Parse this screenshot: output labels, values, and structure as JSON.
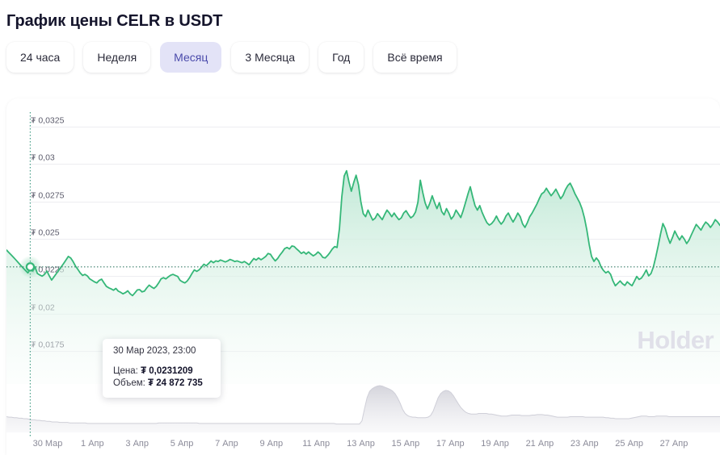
{
  "header": {
    "title": "График цены CELR в USDT"
  },
  "range_selector": {
    "options": [
      {
        "label": "24 часа",
        "active": false
      },
      {
        "label": "Неделя",
        "active": false
      },
      {
        "label": "Месяц",
        "active": true
      },
      {
        "label": "3 Месяца",
        "active": false
      },
      {
        "label": "Год",
        "active": false
      },
      {
        "label": "Всё время",
        "active": false
      }
    ],
    "active_label": "Месяц"
  },
  "watermark": {
    "text": "Holder"
  },
  "tooltip": {
    "date": "30 Мар 2023, 23:00",
    "price_label": "Цена:",
    "price_value": "₮ 0,0231209",
    "volume_label": "Объем:",
    "volume_value": "₮ 24 872 735"
  },
  "colors": {
    "line": "#35b778",
    "area_top": "#cfeedf",
    "area_bottom": "#f6fcf9",
    "volume": "#dcdce2",
    "grid": "#ededf1",
    "crosshair": "#4aa08a",
    "accent_button_bg": "#e3e3f7",
    "accent_button_text": "#4b4bab",
    "watermark": "#e0e0e9"
  },
  "chart_data": {
    "type": "area",
    "title": "График цены CELR в USDT",
    "xlabel": "",
    "ylabel": "",
    "grid": true,
    "legend": "none",
    "currency_symbol": "₮",
    "y_ticks": [
      0.0325,
      0.03,
      0.0275,
      0.025,
      0.0225,
      0.02,
      0.0175
    ],
    "y_tick_labels": [
      "₮ 0,0325",
      "₮ 0,03",
      "₮ 0,0275",
      "₮ 0,025",
      "₮ 0,0225",
      "₮ 0,02",
      "₮ 0,0175"
    ],
    "ylim": [
      0.0165,
      0.0333
    ],
    "x_tick_labels": [
      "30 Мар",
      "1 Апр",
      "3 Апр",
      "5 Апр",
      "7 Апр",
      "9 Апр",
      "11 Апр",
      "13 Апр",
      "15 Апр",
      "17 Апр",
      "19 Апр",
      "21 Апр",
      "23 Апр",
      "25 Апр",
      "27 Апр"
    ],
    "x_range": [
      "30 Мар 2023",
      "28 Апр 2023"
    ],
    "highlight_point": {
      "x_label": "30 Мар 2023, 23:00",
      "price": 0.0231209,
      "volume": 24872735
    },
    "series": [
      {
        "name": "Цена",
        "unit": "₮",
        "values": [
          0.02425,
          0.02408,
          0.02392,
          0.02375,
          0.02358,
          0.0234,
          0.02322,
          0.02305,
          0.02288,
          0.02272,
          0.02296,
          0.02285,
          0.02312,
          0.02268,
          0.02258,
          0.0225,
          0.02262,
          0.02284,
          0.02252,
          0.02224,
          0.02246,
          0.02268,
          0.0229,
          0.02312,
          0.02334,
          0.02358,
          0.02382,
          0.02372,
          0.02348,
          0.02318,
          0.02296,
          0.02272,
          0.02255,
          0.02262,
          0.02252,
          0.02232,
          0.02222,
          0.02212,
          0.02205,
          0.02222,
          0.0223,
          0.02205,
          0.02182,
          0.02172,
          0.02165,
          0.02156,
          0.02168,
          0.0215,
          0.02142,
          0.02132,
          0.0214,
          0.02152,
          0.02132,
          0.0212,
          0.02138,
          0.02158,
          0.0216,
          0.02145,
          0.0215,
          0.02172,
          0.0219,
          0.02178,
          0.02168,
          0.02182,
          0.02205,
          0.02232,
          0.0224,
          0.02232,
          0.02245,
          0.02256,
          0.02262,
          0.02255,
          0.02248,
          0.02222,
          0.02212,
          0.02205,
          0.02218,
          0.0224,
          0.02268,
          0.02292,
          0.02282,
          0.02292,
          0.0231,
          0.0233,
          0.0232,
          0.02335,
          0.02352,
          0.0234,
          0.02352,
          0.02348,
          0.02358,
          0.02352,
          0.02345,
          0.02352,
          0.02362,
          0.02356,
          0.02348,
          0.02352,
          0.02346,
          0.0234,
          0.02348,
          0.02338,
          0.02326,
          0.02348,
          0.02368,
          0.02358,
          0.02372,
          0.0236,
          0.0237,
          0.02382,
          0.02402,
          0.02396,
          0.02372,
          0.02352,
          0.02368,
          0.02392,
          0.02412,
          0.02435,
          0.02442,
          0.02432,
          0.02452,
          0.02448,
          0.02432,
          0.02418,
          0.02402,
          0.02412,
          0.02398,
          0.02412,
          0.02398,
          0.02386,
          0.02396,
          0.02412,
          0.02398,
          0.02376,
          0.02372,
          0.02388,
          0.02408,
          0.02432,
          0.02448,
          0.02442,
          0.02568,
          0.02782,
          0.0292,
          0.02955,
          0.0288,
          0.02818,
          0.02876,
          0.02925,
          0.02862,
          0.02748,
          0.02668,
          0.02648,
          0.02692,
          0.02658,
          0.02625,
          0.02638,
          0.02668,
          0.02648,
          0.02628,
          0.02662,
          0.02692,
          0.02672,
          0.02648,
          0.02672,
          0.02648,
          0.02628,
          0.0264,
          0.02672,
          0.02688,
          0.02662,
          0.0264,
          0.02652,
          0.0268,
          0.02745,
          0.02892,
          0.02812,
          0.02742,
          0.027,
          0.02738,
          0.02788,
          0.02742,
          0.02702,
          0.02742,
          0.02682,
          0.0266,
          0.02702,
          0.02672,
          0.02632,
          0.02652,
          0.02692,
          0.02668,
          0.02642,
          0.02688,
          0.02742,
          0.02798,
          0.02848,
          0.02782,
          0.02722,
          0.02692,
          0.02722,
          0.02676,
          0.0264,
          0.02608,
          0.02592,
          0.02602,
          0.02622,
          0.02652,
          0.0262,
          0.02598,
          0.02618,
          0.02652,
          0.02672,
          0.0264,
          0.02612,
          0.0264,
          0.02672,
          0.02648,
          0.026,
          0.02576,
          0.02608,
          0.02648,
          0.02672,
          0.02702,
          0.02732,
          0.02768,
          0.028,
          0.02812,
          0.02838,
          0.02812,
          0.02788,
          0.02808,
          0.02832,
          0.028,
          0.02768,
          0.0279,
          0.02828,
          0.02856,
          0.02872,
          0.0284,
          0.02802,
          0.02772,
          0.02742,
          0.027,
          0.0264,
          0.0256,
          0.02462,
          0.02382,
          0.02348,
          0.02372,
          0.02352,
          0.02312,
          0.02288,
          0.02272,
          0.02282,
          0.02262,
          0.02218,
          0.02186,
          0.02202,
          0.02218,
          0.022,
          0.02188,
          0.02212,
          0.02198,
          0.02186,
          0.02216,
          0.02248,
          0.02228,
          0.02238,
          0.02262,
          0.02292,
          0.02252,
          0.02268,
          0.02312,
          0.02378,
          0.02452,
          0.02532,
          0.02602,
          0.02568,
          0.02512,
          0.0247,
          0.02508,
          0.02552,
          0.0252,
          0.02492,
          0.0252,
          0.02498,
          0.02468,
          0.02492,
          0.02528,
          0.02562,
          0.02596,
          0.02578,
          0.02558,
          0.02588,
          0.02612,
          0.02598,
          0.02576,
          0.02598,
          0.02628,
          0.02612,
          0.0259
        ]
      },
      {
        "name": "Объем",
        "unit": "₮",
        "values": [
          0.3,
          0.29,
          0.29,
          0.28,
          0.28,
          0.27,
          0.27,
          0.26,
          0.26,
          0.25,
          0.24,
          0.24,
          0.23,
          0.23,
          0.22,
          0.22,
          0.21,
          0.21,
          0.2,
          0.2,
          0.2,
          0.19,
          0.19,
          0.19,
          0.19,
          0.18,
          0.18,
          0.18,
          0.18,
          0.18,
          0.18,
          0.18,
          0.17,
          0.17,
          0.17,
          0.17,
          0.17,
          0.17,
          0.17,
          0.17,
          0.17,
          0.17,
          0.17,
          0.17,
          0.17,
          0.17,
          0.17,
          0.17,
          0.17,
          0.17,
          0.17,
          0.17,
          0.17,
          0.17,
          0.17,
          0.17,
          0.17,
          0.17,
          0.17,
          0.17,
          0.18,
          0.18,
          0.18,
          0.18,
          0.18,
          0.18,
          0.18,
          0.18,
          0.18,
          0.18,
          0.18,
          0.18,
          0.18,
          0.18,
          0.18,
          0.18,
          0.17,
          0.17,
          0.17,
          0.17,
          0.17,
          0.17,
          0.17,
          0.17,
          0.17,
          0.17,
          0.17,
          0.17,
          0.17,
          0.17,
          0.17,
          0.17,
          0.17,
          0.17,
          0.17,
          0.17,
          0.17,
          0.17,
          0.17,
          0.17,
          0.17,
          0.17,
          0.17,
          0.17,
          0.17,
          0.17,
          0.17,
          0.17,
          0.17,
          0.17,
          0.17,
          0.17,
          0.17,
          0.17,
          0.17,
          0.17,
          0.17,
          0.17,
          0.17,
          0.17,
          0.17,
          0.17,
          0.17,
          0.17,
          0.17,
          0.17,
          0.17,
          0.17,
          0.17,
          0.17,
          0.16,
          0.16,
          0.16,
          0.16,
          0.16,
          0.16,
          0.16,
          0.16,
          0.16,
          0.16,
          0.22,
          0.45,
          0.66,
          0.78,
          0.83,
          0.86,
          0.88,
          0.89,
          0.88,
          0.86,
          0.84,
          0.82,
          0.79,
          0.74,
          0.66,
          0.56,
          0.44,
          0.36,
          0.32,
          0.3,
          0.29,
          0.29,
          0.28,
          0.28,
          0.28,
          0.28,
          0.29,
          0.32,
          0.4,
          0.53,
          0.66,
          0.74,
          0.78,
          0.8,
          0.79,
          0.76,
          0.7,
          0.62,
          0.54,
          0.47,
          0.42,
          0.38,
          0.36,
          0.35,
          0.35,
          0.35,
          0.36,
          0.36,
          0.36,
          0.36,
          0.35,
          0.35,
          0.34,
          0.33,
          0.32,
          0.31,
          0.31,
          0.31,
          0.32,
          0.33,
          0.33,
          0.33,
          0.33,
          0.32,
          0.32,
          0.32,
          0.32,
          0.33,
          0.33,
          0.34,
          0.34,
          0.34,
          0.33,
          0.33,
          0.32,
          0.31,
          0.3,
          0.29,
          0.29,
          0.29,
          0.29,
          0.29,
          0.3,
          0.3,
          0.3,
          0.3,
          0.3,
          0.3,
          0.29,
          0.29,
          0.29,
          0.29,
          0.29,
          0.29,
          0.29,
          0.29,
          0.28,
          0.28,
          0.27,
          0.27,
          0.26,
          0.26,
          0.26,
          0.26,
          0.26,
          0.26,
          0.27,
          0.28,
          0.29,
          0.3,
          0.31,
          0.31,
          0.31,
          0.3,
          0.3,
          0.3,
          0.31,
          0.31,
          0.31,
          0.31,
          0.31,
          0.3,
          0.3,
          0.3,
          0.3,
          0.3,
          0.3,
          0.3,
          0.3,
          0.3,
          0.3,
          0.3,
          0.3,
          0.3,
          0.3,
          0.3,
          0.3,
          0.3,
          0.3,
          0.3,
          0.3,
          0.3
        ]
      }
    ]
  }
}
